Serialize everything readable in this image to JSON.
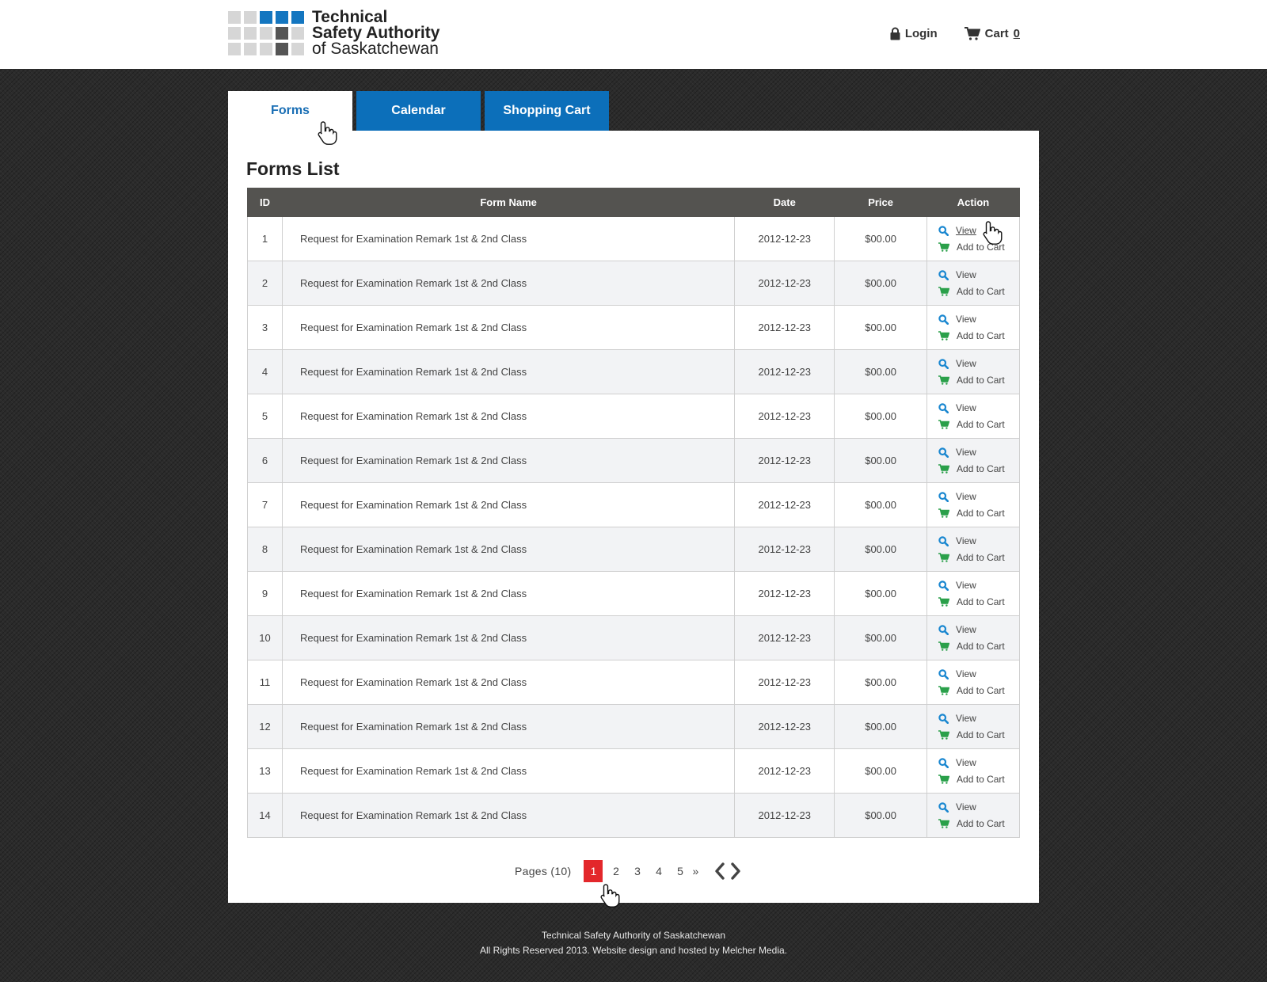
{
  "logo": {
    "line1": "Technical",
    "line2": "Safety Authority",
    "line3": "of Saskatchewan",
    "grid_colors": [
      "#d6d6d6",
      "#d6d6d6",
      "#1476c0",
      "#1476c0",
      "#1476c0",
      "#d6d6d6",
      "#d6d6d6",
      "#d6d6d6",
      "#555555",
      "#d6d6d6",
      "#d6d6d6",
      "#d6d6d6",
      "#d6d6d6",
      "#555555",
      "#d6d6d6"
    ]
  },
  "topnav": {
    "login_label": "Login",
    "login_icon": "lock-icon",
    "cart_label": "Cart",
    "cart_count": "0",
    "cart_icon": "cart-icon"
  },
  "tabs": [
    {
      "label": "Forms",
      "active": true
    },
    {
      "label": "Calendar",
      "active": false
    },
    {
      "label": "Shopping Cart",
      "active": false
    }
  ],
  "page_title": "Forms List",
  "table": {
    "headers": [
      "ID",
      "Form Name",
      "Date",
      "Price",
      "Action"
    ],
    "view_label": "View",
    "add_label": "Add to Cart",
    "rows": [
      {
        "id": "1",
        "name": "Request for Examination Remark 1st & 2nd Class",
        "date": "2012-12-23",
        "price": "$00.00"
      },
      {
        "id": "2",
        "name": "Request for Examination Remark 1st & 2nd Class",
        "date": "2012-12-23",
        "price": "$00.00"
      },
      {
        "id": "3",
        "name": "Request for Examination Remark 1st & 2nd Class",
        "date": "2012-12-23",
        "price": "$00.00"
      },
      {
        "id": "4",
        "name": "Request for Examination Remark 1st & 2nd Class",
        "date": "2012-12-23",
        "price": "$00.00"
      },
      {
        "id": "5",
        "name": "Request for Examination Remark 1st & 2nd Class",
        "date": "2012-12-23",
        "price": "$00.00"
      },
      {
        "id": "6",
        "name": "Request for Examination Remark 1st & 2nd Class",
        "date": "2012-12-23",
        "price": "$00.00"
      },
      {
        "id": "7",
        "name": "Request for Examination Remark 1st & 2nd Class",
        "date": "2012-12-23",
        "price": "$00.00"
      },
      {
        "id": "8",
        "name": "Request for Examination Remark 1st & 2nd Class",
        "date": "2012-12-23",
        "price": "$00.00"
      },
      {
        "id": "9",
        "name": "Request for Examination Remark 1st & 2nd Class",
        "date": "2012-12-23",
        "price": "$00.00"
      },
      {
        "id": "10",
        "name": "Request for Examination Remark 1st & 2nd Class",
        "date": "2012-12-23",
        "price": "$00.00"
      },
      {
        "id": "11",
        "name": "Request for Examination Remark 1st & 2nd Class",
        "date": "2012-12-23",
        "price": "$00.00"
      },
      {
        "id": "12",
        "name": "Request for Examination Remark 1st & 2nd Class",
        "date": "2012-12-23",
        "price": "$00.00"
      },
      {
        "id": "13",
        "name": "Request for Examination Remark 1st & 2nd Class",
        "date": "2012-12-23",
        "price": "$00.00"
      },
      {
        "id": "14",
        "name": "Request for Examination Remark 1st & 2nd Class",
        "date": "2012-12-23",
        "price": "$00.00"
      }
    ]
  },
  "pager": {
    "label": "Pages (10)",
    "pages": [
      "1",
      "2",
      "3",
      "4",
      "5"
    ],
    "current": "1",
    "more": "»",
    "prev_icon": "chevron-left-icon",
    "next_icon": "chevron-right-icon"
  },
  "footer": {
    "line1": "Technical Safety Authority of Saskatchewan",
    "line2": "All Rights Reserved 2013. Website design and hosted by Melcher Media."
  },
  "colors": {
    "tab_blue": "#0c6fba",
    "header_dark": "#545350",
    "current_page_red": "#e3272b",
    "view_icon_blue": "#1a87d0",
    "cart_icon_green": "#2aa04a"
  }
}
